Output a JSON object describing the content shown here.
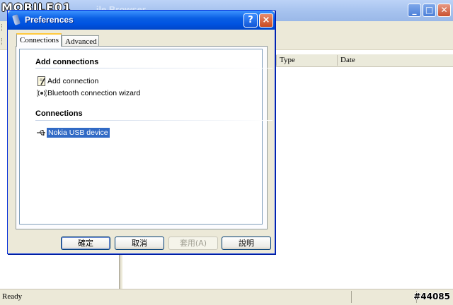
{
  "main_window": {
    "title": "...ile Browser",
    "controls": [
      "minimize-icon",
      "maximize-icon",
      "close-icon"
    ],
    "columns": [
      "Type",
      "Date"
    ],
    "status": "Ready"
  },
  "watermark": {
    "logo": "MOBILE01",
    "id": "#44085"
  },
  "dialog": {
    "title": "Preferences",
    "help_glyph": "?",
    "close_glyph": "×",
    "tabs": [
      {
        "label": "Connections",
        "active": true
      },
      {
        "label": "Advanced",
        "active": false
      }
    ],
    "sections": {
      "add_connections": {
        "heading": "Add connections",
        "items": [
          {
            "label": "Add connection",
            "icon": "add-connection-icon"
          },
          {
            "label": "Bluetooth connection wizard",
            "icon": "bluetooth-icon"
          }
        ]
      },
      "connections": {
        "heading": "Connections",
        "items": [
          {
            "label": "Nokia USB device",
            "icon": "usb-icon",
            "selected": true
          }
        ]
      }
    },
    "buttons": {
      "ok": "確定",
      "cancel": "取消",
      "apply": "套用(A)",
      "help": "說明"
    }
  },
  "colors": {
    "titlebar_blue": "#0053e1",
    "selection": "#316ac5",
    "dialog_face": "#ece9d8"
  }
}
